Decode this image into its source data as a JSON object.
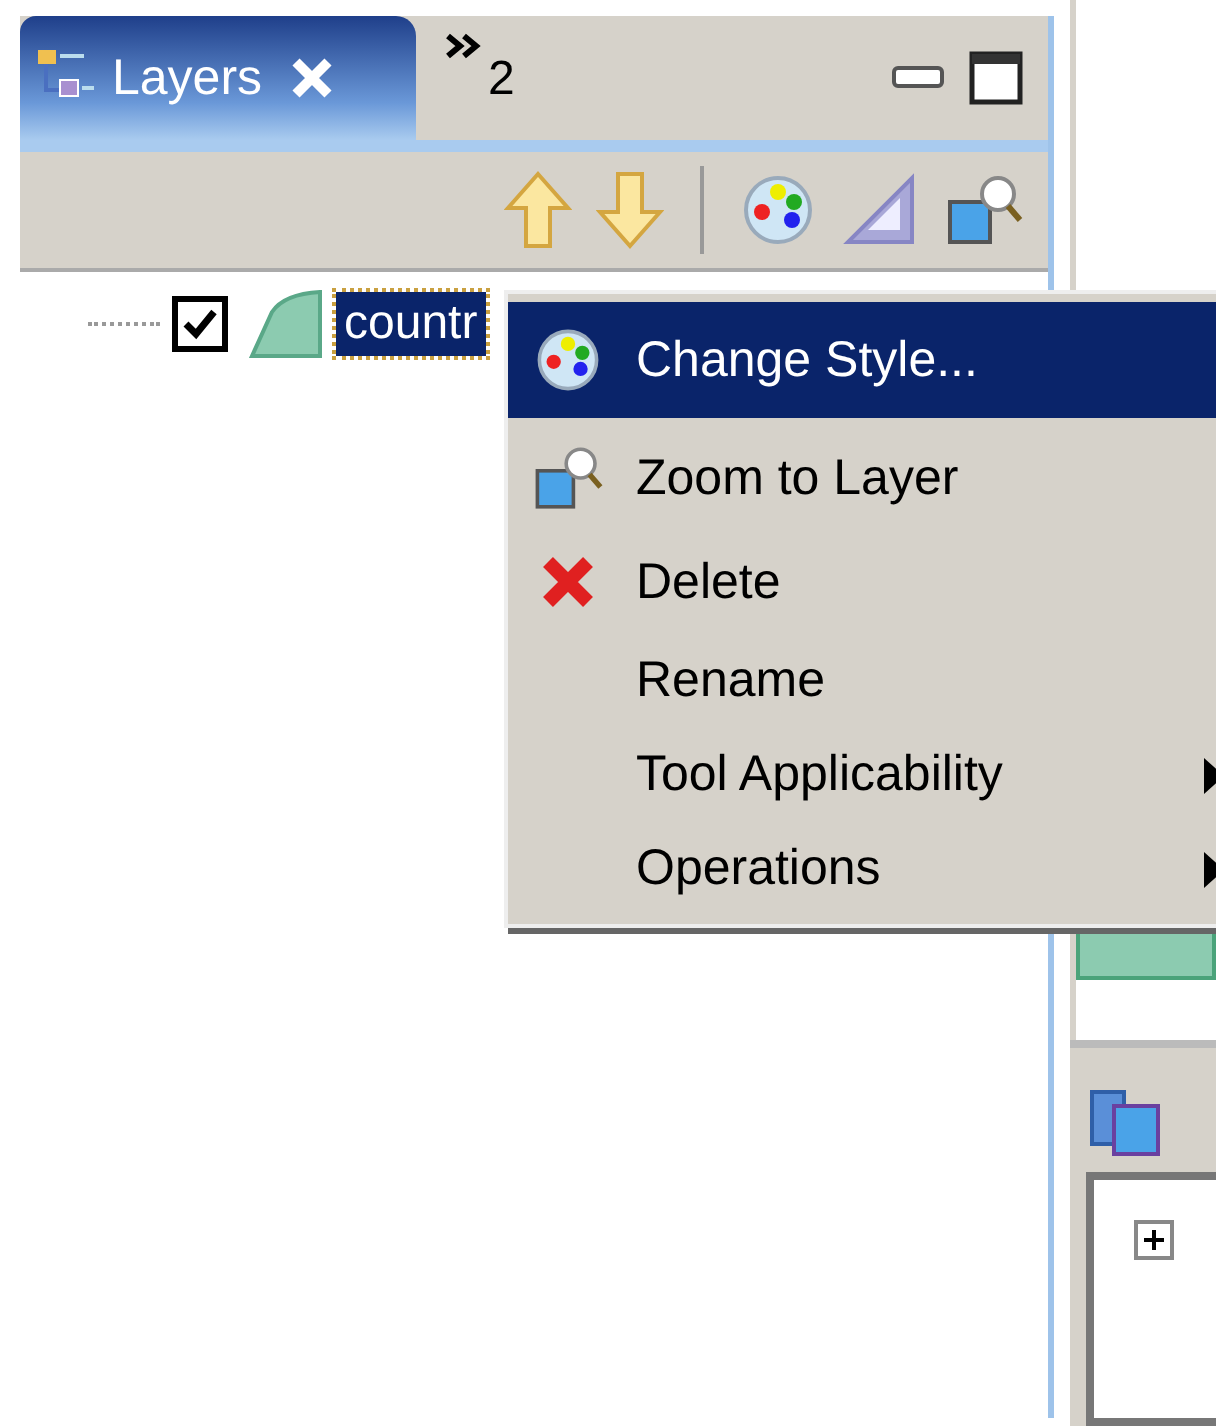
{
  "tabs": [
    {
      "label": "Layers",
      "selected": true
    }
  ],
  "overflow_count": "2",
  "layers": [
    {
      "name": "countr",
      "checked": true,
      "selected": true
    }
  ],
  "context_menu": [
    {
      "label": "Change Style...",
      "selected": true,
      "submenu": false
    },
    {
      "label": "Zoom to Layer",
      "selected": false,
      "submenu": false
    },
    {
      "label": "Delete",
      "selected": false,
      "submenu": false
    },
    {
      "label": "Rename",
      "selected": false,
      "submenu": false
    },
    {
      "label": "Tool Applicability",
      "selected": false,
      "submenu": true
    },
    {
      "label": "Operations",
      "selected": false,
      "submenu": true
    }
  ]
}
